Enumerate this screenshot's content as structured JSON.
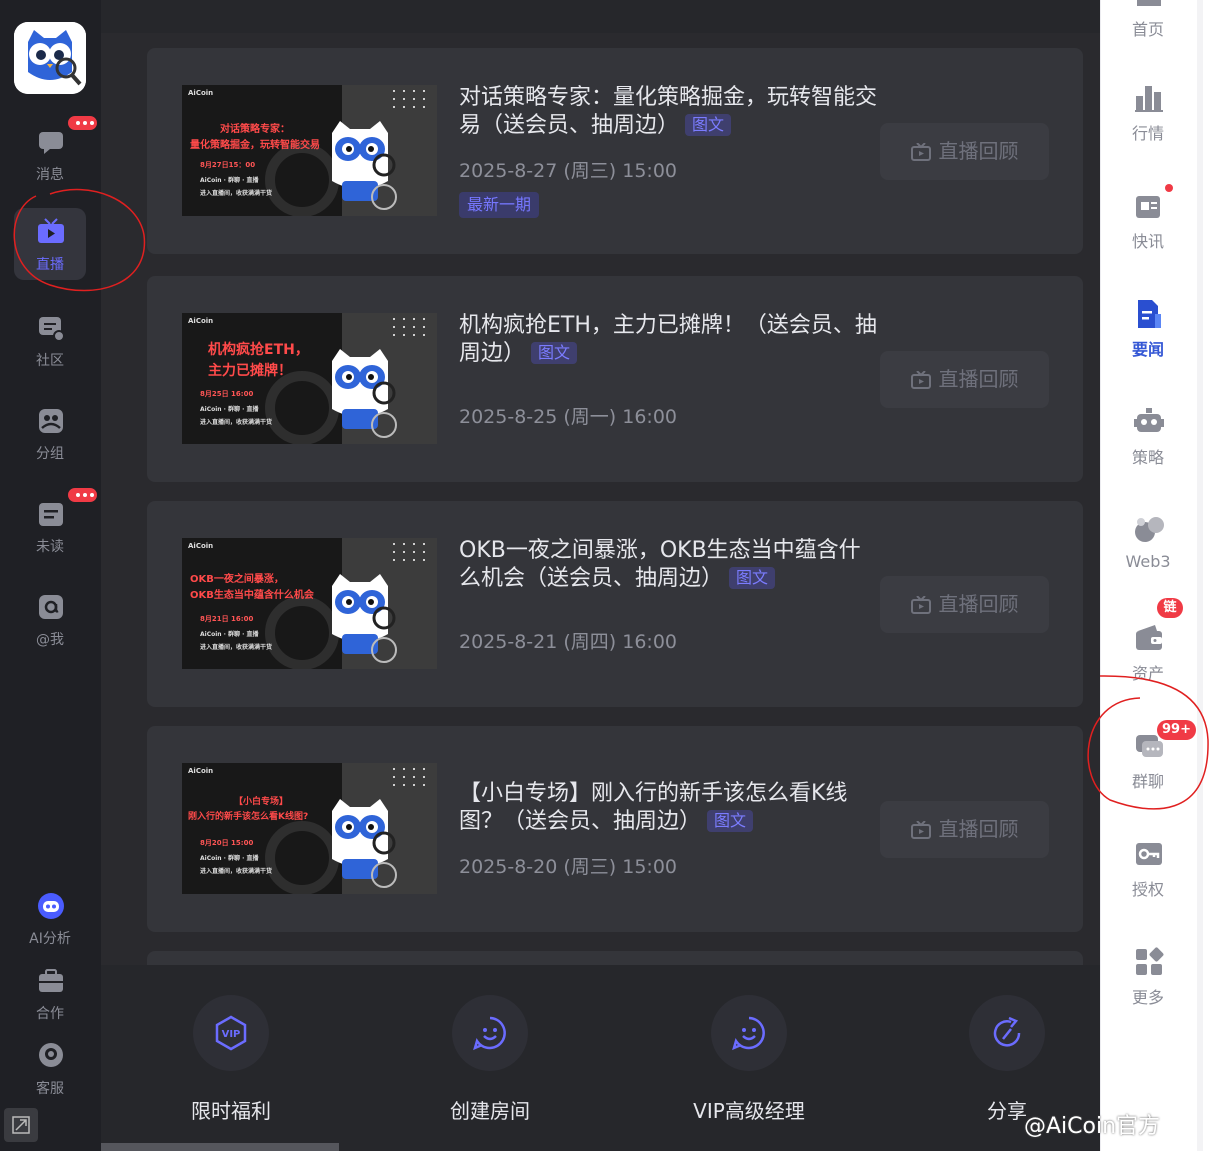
{
  "left_nav": {
    "items": [
      {
        "label": "消息",
        "icon": "chat-bubble-icon",
        "badge": "dots"
      },
      {
        "label": "直播",
        "icon": "tv-live-icon",
        "active": true
      },
      {
        "label": "社区",
        "icon": "community-icon"
      },
      {
        "label": "分组",
        "icon": "group-icon"
      },
      {
        "label": "未读",
        "icon": "unread-icon",
        "badge": "dots"
      },
      {
        "label": "@我",
        "icon": "at-icon"
      }
    ],
    "bottom_items": [
      {
        "label": "AI分析",
        "icon": "ai-robot-icon"
      },
      {
        "label": "合作",
        "icon": "briefcase-icon"
      },
      {
        "label": "客服",
        "icon": "customer-service-icon"
      }
    ]
  },
  "streams": [
    {
      "title": "对话策略专家：量化策略掘金，玩转智能交易（送会员、抽周边）",
      "tag": "图文",
      "time": "2025-8-27 (周三) 15:00",
      "latest_label": "最新一期",
      "replay_label": "直播回顾",
      "thumb": {
        "brand": "AiCoin",
        "lines": [
          "对话策略专家：",
          "量化策略掘金，玩转智能交易"
        ],
        "date": "8月27日15：00",
        "sub1": "AiCoin · 群聊 · 直播",
        "sub2": "进入直播间，收获满满干货"
      }
    },
    {
      "title": "机构疯抢ETH，主力已摊牌！（送会员、抽周边）",
      "tag": "图文",
      "time": "2025-8-25 (周一) 16:00",
      "replay_label": "直播回顾",
      "thumb": {
        "brand": "AiCoin",
        "lines": [
          "机构疯抢ETH，",
          "主力已摊牌！"
        ],
        "date": "8月25日 16:00",
        "sub1": "AiCoin · 群聊 · 直播",
        "sub2": "进入直播间，收获满满干货"
      }
    },
    {
      "title": "OKB一夜之间暴涨，OKB生态当中蕴含什么机会（送会员、抽周边）",
      "tag": "图文",
      "time": "2025-8-21 (周四) 16:00",
      "replay_label": "直播回顾",
      "thumb": {
        "brand": "AiCoin",
        "lines": [
          "OKB一夜之间暴涨，",
          "OKB生态当中蕴含什么机会"
        ],
        "date": "8月21日 16:00",
        "sub1": "AiCoin · 群聊 · 直播",
        "sub2": "进入直播间，收获满满干货"
      }
    },
    {
      "title": "【小白专场】刚入行的新手该怎么看K线图？（送会员、抽周边）",
      "tag": "图文",
      "time": "2025-8-20 (周三) 15:00",
      "replay_label": "直播回顾",
      "thumb": {
        "brand": "AiCoin",
        "lines": [
          "【小白专场】",
          "刚入行的新手该怎么看K线图?"
        ],
        "date": "8月20日 15:00",
        "sub1": "AiCoin · 群聊 · 直播",
        "sub2": "进入直播间，收获满满干货"
      }
    }
  ],
  "bottom_actions": [
    {
      "label": "限时福利",
      "icon": "vip-icon"
    },
    {
      "label": "创建房间",
      "icon": "smile-chat-icon"
    },
    {
      "label": "VIP高级经理",
      "icon": "smile-chat-icon"
    },
    {
      "label": "分享",
      "icon": "share-refresh-icon"
    }
  ],
  "right_nav": {
    "items": [
      {
        "label": "首页",
        "icon": "home-icon"
      },
      {
        "label": "行情",
        "icon": "bar-chart-icon"
      },
      {
        "label": "快讯",
        "icon": "newsflash-icon",
        "dot": true
      },
      {
        "label": "要闻",
        "icon": "document-icon",
        "active": true
      },
      {
        "label": "策略",
        "icon": "robot-icon"
      },
      {
        "label": "Web3",
        "icon": "web3-icon"
      },
      {
        "label": "资产",
        "icon": "wallet-icon",
        "badge": "链上"
      },
      {
        "label": "群聊",
        "icon": "group-chat-icon",
        "badge": "99+"
      },
      {
        "label": "授权",
        "icon": "key-icon"
      },
      {
        "label": "更多",
        "icon": "grid-more-icon"
      }
    ]
  },
  "watermark": "@AiCoin官方"
}
